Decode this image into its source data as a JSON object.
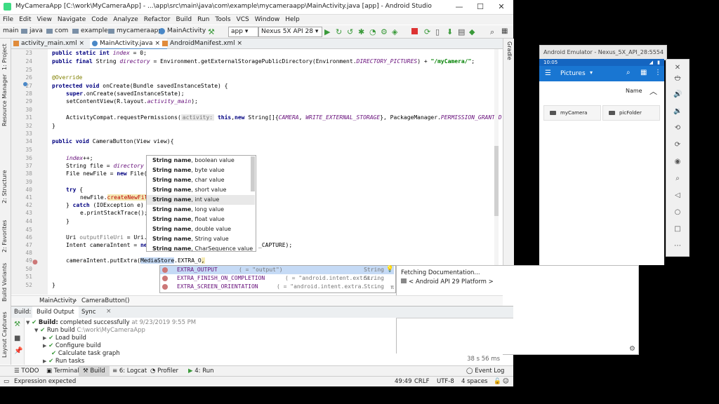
{
  "window": {
    "title": "MyCameraApp [C:\\work\\MyCameraApp] - ...\\app\\src\\main\\java\\com\\example\\mycameraapp\\MainActivity.java [app] - Android Studio",
    "minimize": "—",
    "maximize": "☐",
    "close": "✕"
  },
  "menu": [
    "File",
    "Edit",
    "View",
    "Navigate",
    "Code",
    "Analyze",
    "Refactor",
    "Build",
    "Run",
    "Tools",
    "VCS",
    "Window",
    "Help"
  ],
  "breadcrumb": [
    "main",
    "java",
    "com",
    "example",
    "mycameraapp",
    "MainActivity"
  ],
  "run_config": "app",
  "device": "Nexus 5X API 28",
  "tabs": [
    "activity_main.xml",
    "MainActivity.java",
    "AndroidManifest.xml"
  ],
  "left_tools": [
    "1: Project",
    "Resource Manager",
    "2: Structure",
    "2: Favorites",
    "Build Variants",
    "Layout Captures"
  ],
  "right_tools": [
    "Gradle"
  ],
  "line_numbers": [
    "23",
    "24",
    "25",
    "26",
    "27",
    "28",
    "29",
    "30",
    "31",
    "32",
    "33",
    "34",
    "35",
    "36",
    "37",
    "38",
    "39",
    "40",
    "41",
    "42",
    "43",
    "44",
    "45",
    "46",
    "47",
    "48",
    "49",
    "50",
    "51",
    "52"
  ],
  "code": {
    "l23_kw": "public static int ",
    "l23_fl": "index",
    "l23_rest": " = 0;",
    "l24_kw": "public final ",
    "l24_a": "String ",
    "l24_fl": "directory",
    "l24_b": " = Environment.getExternalStoragePublicDirectory(Environment.",
    "l24_c": "DIRECTORY_PICTURES",
    "l24_d": ") + ",
    "l24_str": "\"/myCamera/\"",
    "l24_e": ";",
    "l26": "@Override",
    "l27_kw": "protected void ",
    "l27_rest": "onCreate(Bundle savedInstanceState) {",
    "l28_kw": "super",
    "l28_rest": ".onCreate(savedInstanceState);",
    "l29_a": "setContentView(R.layout.",
    "l29_b": "activity_main",
    "l29_c": ");",
    "l31_a": "ActivityCompat.requestPermissions(",
    "l31_hint": "activity:",
    "l31_kw": " this",
    "l31_b": ",",
    "l31_kw2": "new ",
    "l31_c": "String[]{",
    "l31_d": "CAMERA",
    "l31_e": ", ",
    "l31_f": "WRITE_EXTERNAL_STORAGE",
    "l31_g": "}, PackageManager.",
    "l31_h": "PERMISSION_GRANTED",
    "l31_i": ");",
    "l32": "}",
    "l34_kw": "public void ",
    "l34_rest": "CameraButton(View view){",
    "l36_fl": "index",
    "l36_rest": "++;",
    "l37_a": "String file = ",
    "l37_fl": "directory",
    "l38_a": "File newFile = ",
    "l38_kw": "new ",
    "l38_b": "File(",
    "l40_kw": "try",
    "l40_rest": " {",
    "l41_a": "newFile.",
    "l41_b": "createNewFil",
    "l42_a": "} ",
    "l42_kw": "catch",
    "l42_b": " (IOException e)",
    "l43": "e.printStackTrace();",
    "l44": "}",
    "l46_a": "Uri ",
    "l46_b": "outputFileUri",
    "l46_c": " = Uri.",
    "l47_a": "Intent cameraIntent = ",
    "l47_kw": "ne",
    "l47_b": "_CAPTURE);",
    "l49_a": "cameraIntent.putExtra(",
    "l49_b": "MediaStore",
    "l49_c": ".EXTRA_O",
    "l49_d": ",",
    "l51": "}"
  },
  "param_hints": [
    {
      "name": "String name",
      "rest": ", boolean value"
    },
    {
      "name": "String name",
      "rest": ", byte value"
    },
    {
      "name": "String name",
      "rest": ", char value"
    },
    {
      "name": "String name",
      "rest": ", short value"
    },
    {
      "name": "String name",
      "rest": ", int value"
    },
    {
      "name": "String name",
      "rest": ", long value"
    },
    {
      "name": "String name",
      "rest": ", float value"
    },
    {
      "name": "String name",
      "rest": ", double value"
    },
    {
      "name": "String name",
      "rest": ", String value"
    },
    {
      "name": "String name",
      "rest": ", CharSequence value"
    }
  ],
  "completion": [
    {
      "name": "EXTRA_OUTPUT",
      "value": "( = \"output\")",
      "type": "String"
    },
    {
      "name": "EXTRA_FINISH_ON_COMPLETION",
      "value": "( = \"android.intent.extra...",
      "type": "String"
    },
    {
      "name": "EXTRA_SCREEN_ORIENTATION",
      "value": "( = \"android.intent.extra. ...",
      "type": "String"
    }
  ],
  "doc_popup": {
    "status": "Fetching Documentation...",
    "platform": "< Android API 29 Platform >"
  },
  "code_breadcrumb": [
    "MainActivity",
    "CameraButton()"
  ],
  "build_tabs": {
    "label": "Build:",
    "tabs": [
      "Build Output",
      "Sync"
    ]
  },
  "build_tree": {
    "root_label": "Build:",
    "root_text": " completed successfully",
    "root_time": " at 9/23/2019 9:55 PM",
    "run_label": "Run build",
    "run_path": " C:\\work\\MyCameraApp",
    "items": [
      "Load build",
      "Configure build",
      "Calculate task graph",
      "Run tasks"
    ]
  },
  "build_duration": "38 s 56 ms",
  "bottom_tabs": [
    "TODO",
    "Terminal",
    "Build",
    "6: Logcat",
    "Profiler",
    "4: Run"
  ],
  "event_log": "Event Log",
  "status": {
    "message": "Expression expected",
    "position": "49:49",
    "line_sep": "CRLF",
    "encoding": "UTF-8",
    "indent": "4 spaces"
  },
  "emulator": {
    "title": "Android Emulator - Nexus_5X_API_28:5554",
    "time": "10:05",
    "app_title": "Pictures",
    "sort_label": "Name",
    "folders": [
      "myCamera",
      "picFolder"
    ]
  },
  "colors": {
    "accent": "#1976d2",
    "selection": "#c5daf5",
    "check": "#3a9a3a"
  }
}
